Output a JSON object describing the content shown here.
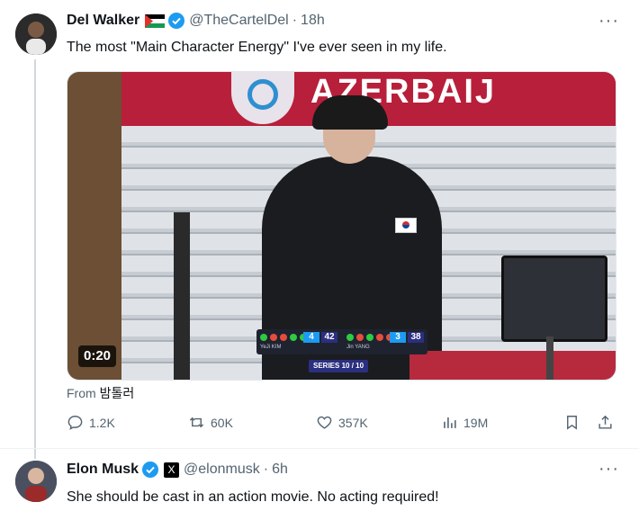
{
  "tweet1": {
    "name": "Del Walker",
    "handle": "@TheCartelDel",
    "dot": "·",
    "time": "18h",
    "more": "···",
    "text": "The most \"Main Character Energy\" I've ever seen in my life.",
    "video": {
      "banner_text": "AZERBAIJ",
      "duration": "0:20",
      "series_label": "SERIES 10 / 10",
      "scoreboard": {
        "left_score_small": "4",
        "left_score": "42",
        "left_name": "YeJi KIM",
        "right_score_small": "3",
        "right_score": "38",
        "right_name": "Jin YANG"
      }
    },
    "from_prefix": "From",
    "from_name": "밤톨러",
    "stats": {
      "replies": "1.2K",
      "retweets": "60K",
      "likes": "357K",
      "views": "19M"
    }
  },
  "tweet2": {
    "name": "Elon Musk",
    "badge": "X",
    "handle": "@elonmusk",
    "dot": "·",
    "time": "6h",
    "more": "···",
    "text": "She should be cast in an action movie. No  acting required!"
  },
  "colors": {
    "verified_blue": "#1d9bf0",
    "muted": "#536471",
    "thread_line": "#cfd9de"
  }
}
